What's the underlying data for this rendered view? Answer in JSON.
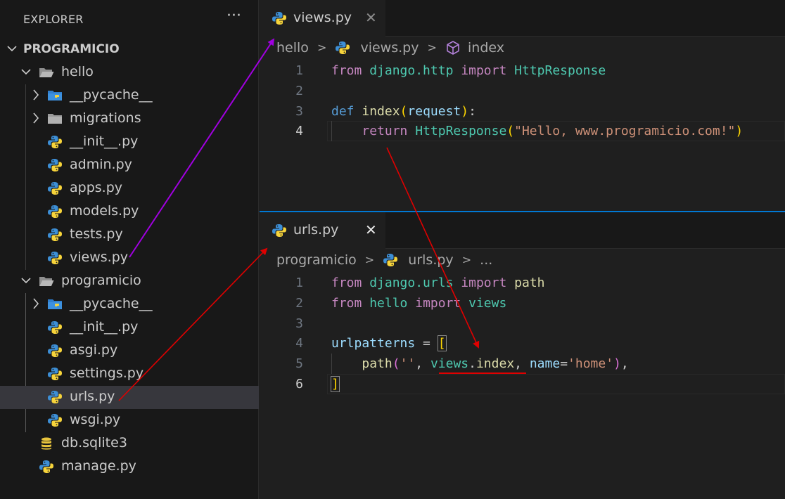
{
  "explorer": {
    "title": "EXPLORER",
    "more_label": "···",
    "root": "PROGRAMICIO",
    "items": [
      {
        "label": "hello"
      },
      {
        "label": "__pycache__"
      },
      {
        "label": "migrations"
      },
      {
        "label": "__init__.py"
      },
      {
        "label": "admin.py"
      },
      {
        "label": "apps.py"
      },
      {
        "label": "models.py"
      },
      {
        "label": "tests.py"
      },
      {
        "label": "views.py"
      },
      {
        "label": "programicio"
      },
      {
        "label": "__pycache__"
      },
      {
        "label": "__init__.py"
      },
      {
        "label": "asgi.py"
      },
      {
        "label": "settings.py"
      },
      {
        "label": "urls.py"
      },
      {
        "label": "wsgi.py"
      },
      {
        "label": "db.sqlite3"
      },
      {
        "label": "manage.py"
      }
    ]
  },
  "top_editor": {
    "tab_label": "views.py",
    "close_label": "✕",
    "breadcrumb": {
      "folder": "hello",
      "file": "views.py",
      "symbol": "index"
    },
    "line_numbers": [
      "1",
      "2",
      "3",
      "4"
    ],
    "code": {
      "l1": {
        "kw1": "from",
        "mod": "django.http",
        "kw2": "import",
        "cls": "HttpResponse"
      },
      "l3": {
        "kw": "def",
        "fn": "index",
        "open": "(",
        "param": "request",
        "close": ")",
        "colon": ":"
      },
      "l4": {
        "kw": "return",
        "cls": "HttpResponse",
        "open": "(",
        "str": "\"Hello, www.programicio.com!\"",
        "close": ")"
      }
    }
  },
  "bottom_editor": {
    "tab_label": "urls.py",
    "close_label": "✕",
    "breadcrumb": {
      "folder": "programicio",
      "file": "urls.py",
      "more": "..."
    },
    "line_numbers": [
      "1",
      "2",
      "3",
      "4",
      "5",
      "6"
    ],
    "code": {
      "l1": {
        "kw1": "from",
        "mod": "django.urls",
        "kw2": "import",
        "name": "path"
      },
      "l2": {
        "kw1": "from",
        "mod": "hello",
        "kw2": "import",
        "name": "views"
      },
      "l4": {
        "var": "urlpatterns",
        "eq": " = ",
        "open": "["
      },
      "l5": {
        "fn": "path",
        "open": "(",
        "str1": "''",
        "comma1": ", ",
        "views": "views",
        "dot": ".",
        "index": "index",
        "comma2": ", ",
        "kwarg": "name",
        "eq": "=",
        "str2": "'home'",
        "close": ")",
        "comma3": ","
      },
      "l6": {
        "close": "]"
      }
    }
  },
  "colors": {
    "focus_border": "#0078d4",
    "arrow_purple": "#a000e0",
    "arrow_red": "#e00000"
  }
}
